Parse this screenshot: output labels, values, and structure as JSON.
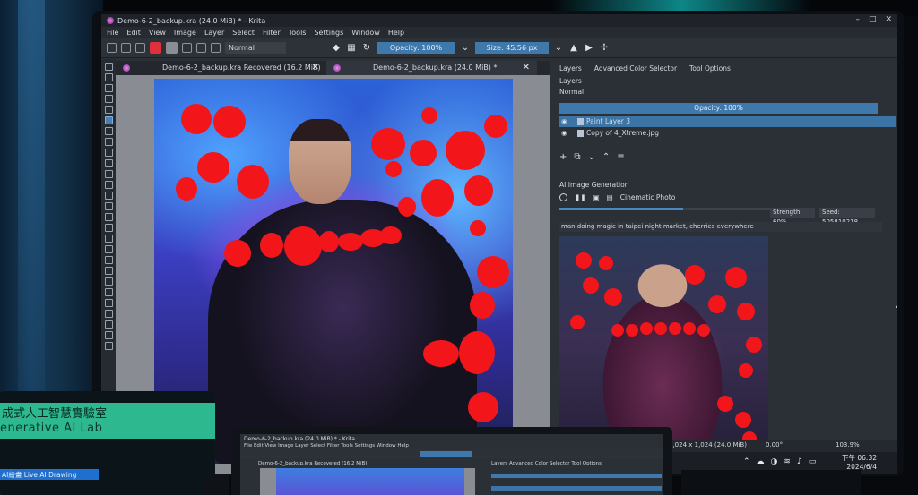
{
  "window": {
    "title": "Demo-6-2_backup.kra (24.0 MiB) * - Krita",
    "controls": [
      "–",
      "□",
      "✕"
    ]
  },
  "menu": [
    "File",
    "Edit",
    "View",
    "Image",
    "Layer",
    "Select",
    "Filter",
    "Tools",
    "Settings",
    "Window",
    "Help"
  ],
  "toolbar": {
    "blend_mode": "Normal",
    "opacity": "Opacity: 100%",
    "size": "Size: 45.56 px",
    "fg_color": "#e0303a",
    "bg_color": "#8a8d93"
  },
  "tabs": [
    {
      "label": "Demo-6-2_backup.kra Recovered (16.2 MiB)",
      "close": "✕"
    },
    {
      "label": "Demo-6-2_backup.kra (24.0 MiB) *",
      "close": "✕"
    }
  ],
  "layers": {
    "dock_tabs": [
      "Layers",
      "Advanced Color Selector",
      "Tool Options"
    ],
    "header": "Layers",
    "blend": "Normal",
    "opacity": "Opacity: 100%",
    "items": [
      {
        "name": "Paint Layer 3",
        "selected": true
      },
      {
        "name": "Copy of 4_Xtreme.jpg",
        "selected": false
      }
    ]
  },
  "ai": {
    "header": "AI Image Generation",
    "style": "Cinematic Photo",
    "strength": "Strength: 60%",
    "seed": "Seed: 505810218",
    "prompt": "man doing magic in taipei night market, cherries everywhere",
    "progress_fraction": 0.55
  },
  "statusbar": {
    "dims": "1,024 x 1,024 (24.0 MiB)",
    "angle": "0.00°",
    "zoom": "103.9%"
  },
  "taskbar": {
    "time": "下午 06:32",
    "date": "2024/6/4"
  },
  "sign": {
    "line1": "成式人工智慧實驗室",
    "line2": "enerative AI Lab",
    "line3": "AI繪畫 Live AI Drawing"
  },
  "laptop": {
    "title": "Demo-6-2_backup.kra (24.0 MiB) * - Krita",
    "menu": "File  Edit  View  Image  Layer  Select  Filter  Tools  Settings  Window  Help",
    "tab": "Demo-6-2_backup.kra Recovered (16.2 MiB)",
    "dock": "Layers    Advanced Color Selector    Tool Options"
  },
  "colors": {
    "accent_blue": "#3f78ab",
    "red_dots": "#f2161b",
    "sign_green": "#2db88f"
  }
}
